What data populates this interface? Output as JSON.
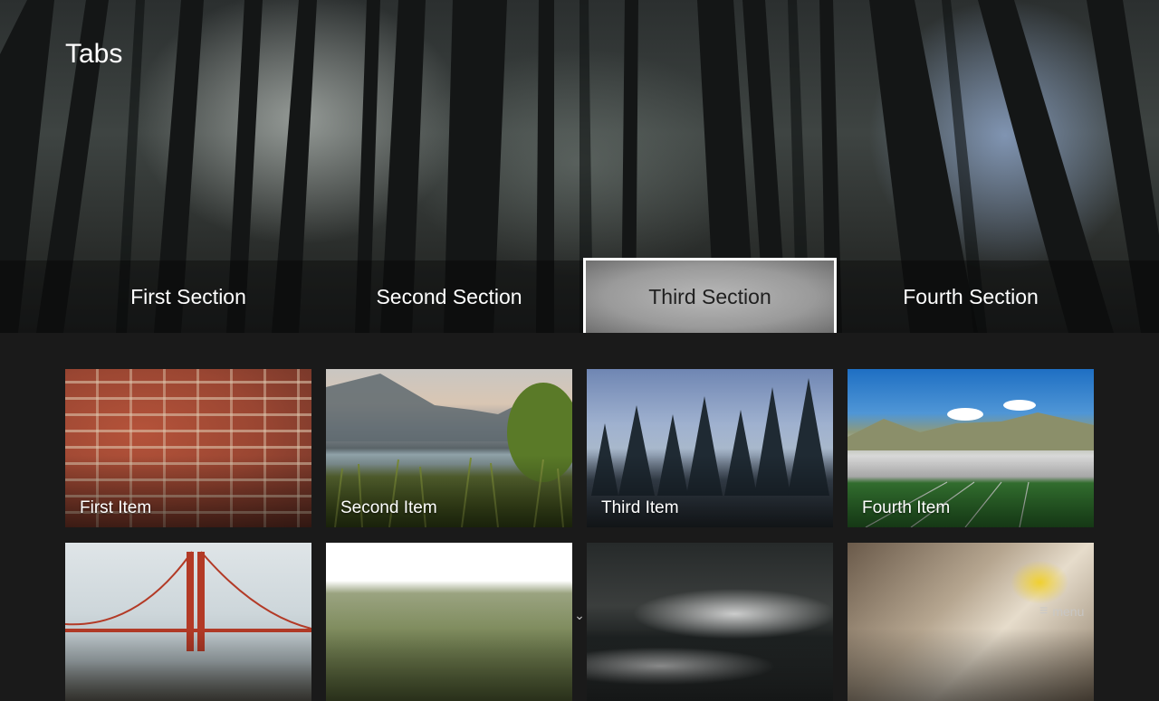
{
  "page": {
    "title": "Tabs"
  },
  "tabs": [
    {
      "label": "First Section",
      "active": false
    },
    {
      "label": "Second Section",
      "active": false
    },
    {
      "label": "Third Section",
      "active": true
    },
    {
      "label": "Fourth Section",
      "active": false
    }
  ],
  "items": [
    {
      "label": "First Item",
      "image": "brick-wall"
    },
    {
      "label": "Second Item",
      "image": "mountain-lake"
    },
    {
      "label": "Third Item",
      "image": "pine-forest"
    },
    {
      "label": "Fourth Item",
      "image": "stadium"
    },
    {
      "label": "",
      "image": "golden-gate-bridge"
    },
    {
      "label": "",
      "image": "wheat-field"
    },
    {
      "label": "",
      "image": "ocean-waves"
    },
    {
      "label": "",
      "image": "coffee-press"
    }
  ],
  "hints": {
    "scroll_icon": "chevron-down-icon",
    "menu_icon": "hamburger-icon",
    "menu_label": "menu"
  },
  "colors": {
    "background": "#1a1a1a",
    "active_tab_border": "#ffffff",
    "text": "#ffffff"
  }
}
